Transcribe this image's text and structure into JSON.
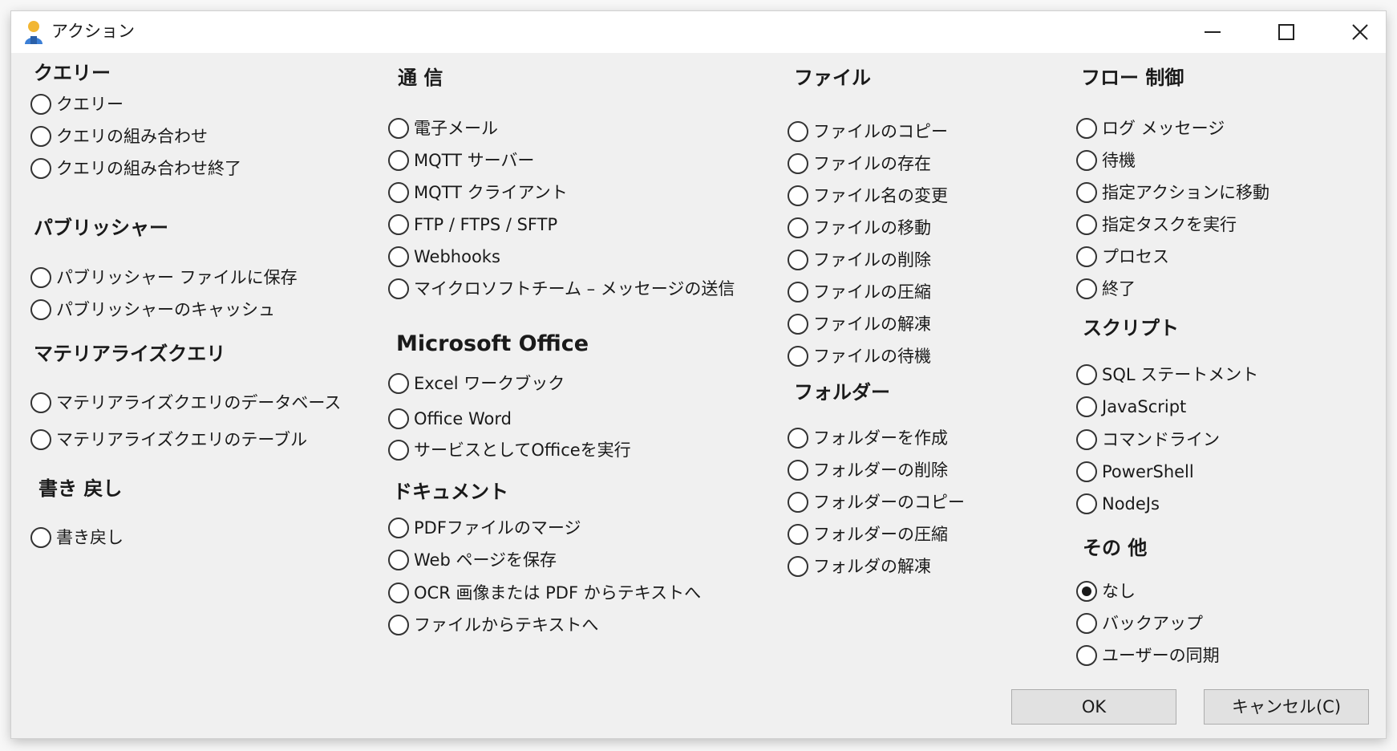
{
  "window": {
    "title": "アクション"
  },
  "col1": {
    "query": {
      "heading": "クエリー",
      "items": [
        "クエリー",
        "クエリの組み合わせ",
        "クエリの組み合わせ終了"
      ]
    },
    "publisher": {
      "heading": "パブリッシャー",
      "items": [
        "パブリッシャー ファイルに保存",
        "パブリッシャーのキャッシュ"
      ]
    },
    "materialized": {
      "heading": "マテリアライズクエリ",
      "items": [
        "マテリアライズクエリのデータベース",
        "マテリアライズクエリのテーブル"
      ]
    },
    "writeback": {
      "heading": "書き 戻し",
      "items": [
        "書き戻し"
      ]
    }
  },
  "col2": {
    "comm": {
      "heading": "通 信",
      "items": [
        "電子メール",
        "MQTT サーバー",
        "MQTT クライアント",
        "FTP / FTPS / SFTP",
        "Webhooks",
        "マイクロソフトチーム – メッセージの送信"
      ]
    },
    "office": {
      "heading": "Microsoft Office",
      "items": [
        "Excel ワークブック",
        "Office Word",
        "サービスとしてOfficeを実行"
      ]
    },
    "document": {
      "heading": "ドキュメント",
      "items": [
        "PDFファイルのマージ",
        "Web ページを保存",
        "OCR 画像または PDF からテキストへ",
        "ファイルからテキストへ"
      ]
    }
  },
  "col3": {
    "file": {
      "heading": "ファイル",
      "items": [
        "ファイルのコピー",
        "ファイルの存在",
        "ファイル名の変更",
        "ファイルの移動",
        "ファイルの削除",
        "ファイルの圧縮",
        "ファイルの解凍",
        "ファイルの待機"
      ]
    },
    "folder": {
      "heading": "フォルダー",
      "items": [
        "フォルダーを作成",
        "フォルダーの削除",
        "フォルダーのコピー",
        "フォルダーの圧縮",
        "フォルダの解凍"
      ]
    }
  },
  "col4": {
    "flow": {
      "heading": "フロー 制御",
      "items": [
        "ログ メッセージ",
        "待機",
        "指定アクションに移動",
        "指定タスクを実行",
        "プロセス",
        "終了"
      ]
    },
    "script": {
      "heading": "スクリプト",
      "items": [
        "SQL ステートメント",
        "JavaScript",
        "コマンドライン",
        "PowerShell",
        "NodeJs"
      ]
    },
    "other": {
      "heading": "その 他",
      "items": [
        "なし",
        "バックアップ",
        "ユーザーの同期"
      ]
    }
  },
  "selected": "なし",
  "buttons": {
    "ok": "OK",
    "cancel": "キャンセル(C)"
  },
  "colors": {
    "window_bg": "#f0f0f0",
    "titlebar_bg": "#ffffff",
    "button_bg": "#e1e1e1",
    "button_border": "#adadad"
  },
  "icons": {
    "app": "user-icon",
    "minimize": "minimize-icon",
    "maximize": "maximize-icon",
    "close": "close-icon"
  }
}
